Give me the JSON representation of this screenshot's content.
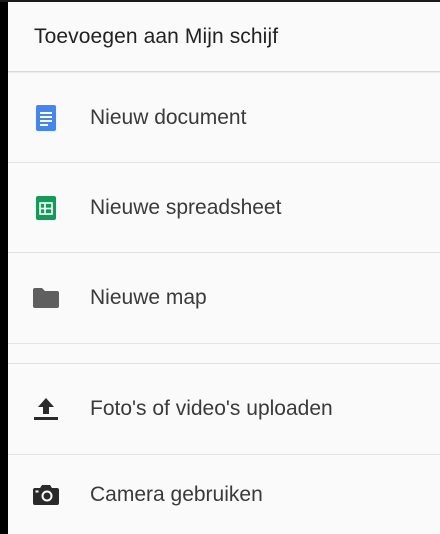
{
  "header": {
    "title": "Toevoegen aan Mijn schijf"
  },
  "menu": {
    "items": [
      {
        "label": "Nieuw document",
        "icon": "docs-icon",
        "color": "#4285f4"
      },
      {
        "label": "Nieuwe spreadsheet",
        "icon": "sheets-icon",
        "color": "#0f9d58"
      },
      {
        "label": "Nieuwe map",
        "icon": "folder-icon",
        "color": "#5f5f5f"
      },
      {
        "label": "Foto's of video's uploaden",
        "icon": "upload-icon",
        "color": "#2a2a2a"
      },
      {
        "label": "Camera gebruiken",
        "icon": "camera-icon",
        "color": "#2a2a2a"
      }
    ]
  }
}
